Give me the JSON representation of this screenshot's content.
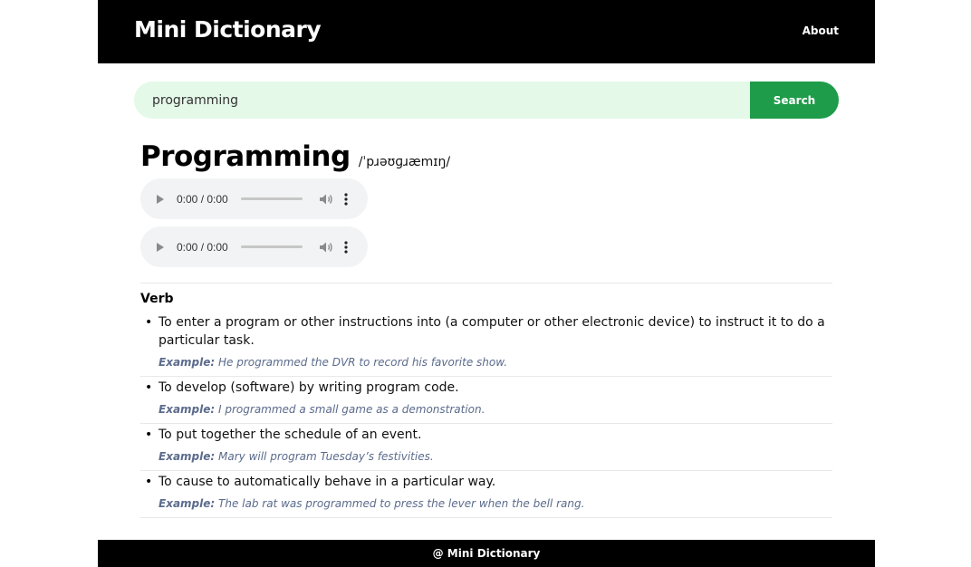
{
  "header": {
    "brand": "Mini Dictionary",
    "about_label": "About"
  },
  "search": {
    "value": "programming",
    "button_label": "Search"
  },
  "entry": {
    "word": "Programming",
    "phonetic": "/ˈpɹəʊɡɹæmɪŋ/",
    "audio_players": [
      {
        "time": "0:00 / 0:00",
        "progress": 0
      },
      {
        "time": "0:00 / 0:00",
        "progress": 0
      }
    ],
    "part_of_speech": "Verb",
    "example_label": "Example:",
    "definitions": [
      {
        "text": "To enter a program or other instructions into (a computer or other electronic device) to instruct it to do a particular task.",
        "example": "He programmed the DVR to record his favorite show."
      },
      {
        "text": "To develop (software) by writing program code.",
        "example": "I programmed a small game as a demonstration."
      },
      {
        "text": "To put together the schedule of an event.",
        "example": "Mary will program Tuesday’s festivities."
      },
      {
        "text": "To cause to automatically behave in a particular way.",
        "example": "The lab rat was programmed to press the lever when the bell rang."
      }
    ]
  },
  "footer": {
    "text": "@ Mini Dictionary"
  },
  "colors": {
    "header_bg": "#000000",
    "search_input_bg": "#e4f9e8",
    "search_button_bg": "#1e9c4a",
    "example_text": "#5b6b8c",
    "audio_bg": "#f1f3f4"
  },
  "icons": [
    "play-icon",
    "volume-icon",
    "more-options-icon"
  ]
}
